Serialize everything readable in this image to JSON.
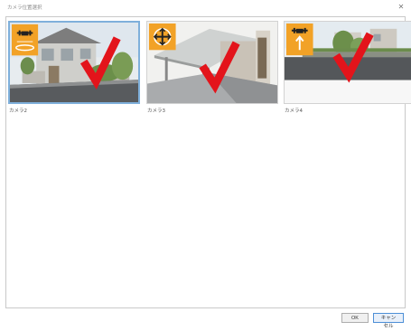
{
  "window": {
    "title": "カメラ位置選択",
    "close_glyph": "✕"
  },
  "cameras": [
    {
      "label": "カメラ2",
      "icon": "drone-overhead-icon",
      "selected": true
    },
    {
      "label": "カメラ3",
      "icon": "move-arrows-icon",
      "selected": false
    },
    {
      "label": "カメラ4",
      "icon": "drone-lift-icon",
      "selected": false
    }
  ],
  "buttons": {
    "ok": "OK",
    "cancel": "キャンセル"
  },
  "colors": {
    "checkmark": "#e3141b",
    "icon_badge": "#f2a227",
    "selection_border": "#7fb0db"
  }
}
